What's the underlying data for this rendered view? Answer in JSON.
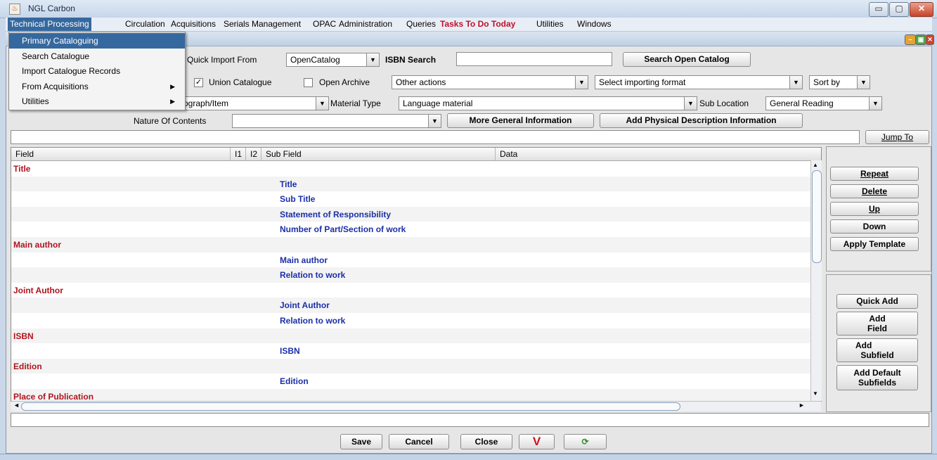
{
  "window": {
    "title": "NGL Carbon",
    "minimize_label": "▭",
    "maximize_label": "▢",
    "close_label": "✕"
  },
  "menubar": {
    "items": [
      {
        "label": "Technical Processing"
      },
      {
        "label": "Circulation"
      },
      {
        "label": "Acquisitions"
      },
      {
        "label": "Serials Management"
      },
      {
        "label": "OPAC"
      },
      {
        "label": "Administration"
      },
      {
        "label": "Queries"
      },
      {
        "label": "Tasks To Do Today"
      },
      {
        "label": "Utilities"
      },
      {
        "label": "Windows"
      }
    ]
  },
  "dropdown": {
    "items": [
      {
        "label": "Primary Cataloguing"
      },
      {
        "label": "Search Catalogue"
      },
      {
        "label": "Import Catalogue Records"
      },
      {
        "label": "From Acquisitions"
      },
      {
        "label": "Utilities"
      }
    ],
    "submenu_arrow": "▶"
  },
  "toolbar": {
    "quick_import_label": "Quick Import From",
    "quick_import_value": "OpenCatalog",
    "isbn_search_label": "ISBN Search",
    "isbn_search_value": "",
    "search_open_catalog": "Search Open Catalog",
    "union_catalogue_label": "Union Catalogue",
    "union_catalogue_checked": true,
    "open_archive_label": "Open Archive",
    "open_archive_checked": false,
    "other_actions_value": "Other actions",
    "importing_format_value": "Select importing format",
    "sort_by_value": "Sort by",
    "record_type_value": "ograph/Item",
    "material_type_label": "Material Type",
    "material_type_value": "Language material",
    "sub_location_label": "Sub Location",
    "sub_location_value": "General Reading",
    "nature_of_contents_label": "Nature Of Contents",
    "nature_of_contents_value": "",
    "more_general_info": "More General Information",
    "add_physical_desc": "Add Physical Description Information",
    "jump_to_value": "",
    "jump_to_label": "Jump To",
    "dropdown_arrow": "▼",
    "check_mark": "✓"
  },
  "table": {
    "columns": [
      "Field",
      "I1",
      "I2",
      "Sub Field",
      "Data"
    ],
    "rows": [
      {
        "field": "Title",
        "subfield": ""
      },
      {
        "field": "",
        "subfield": "Title"
      },
      {
        "field": "",
        "subfield": "Sub Title"
      },
      {
        "field": "",
        "subfield": "Statement of Responsibility"
      },
      {
        "field": "",
        "subfield": "Number of Part/Section of work"
      },
      {
        "field": "Main author",
        "subfield": ""
      },
      {
        "field": "",
        "subfield": "Main author"
      },
      {
        "field": "",
        "subfield": "Relation to work"
      },
      {
        "field": "Joint Author",
        "subfield": ""
      },
      {
        "field": "",
        "subfield": "Joint Author"
      },
      {
        "field": "",
        "subfield": "Relation to work"
      },
      {
        "field": "ISBN",
        "subfield": ""
      },
      {
        "field": "",
        "subfield": "ISBN"
      },
      {
        "field": "Edition",
        "subfield": ""
      },
      {
        "field": "",
        "subfield": "Edition"
      },
      {
        "field": "Place of Publication",
        "subfield": ""
      }
    ],
    "scroll_up": "▲",
    "scroll_down": "▼",
    "scroll_left": "◄",
    "scroll_right": "►"
  },
  "side_panel": {
    "repeat": "Repeat",
    "delete": "Delete",
    "up": "Up",
    "down": "Down",
    "apply_template": "Apply Template",
    "quick_add": "Quick Add",
    "add_field_1": "Add",
    "add_field_2": "Field",
    "add_subfield_1": "Add",
    "add_subfield_2": "Subfield",
    "add_default_1": "Add Default",
    "add_default_2": "Subfields"
  },
  "footer": {
    "status_value": "",
    "save": "Save",
    "cancel": "Cancel",
    "close": "Close",
    "validate_icon": "V",
    "refresh_icon": "⟳"
  },
  "colors": {
    "accent": "#35689e",
    "field_text": "#b0141e",
    "subfield_text": "#1b2fa8",
    "todo_text": "#c0102a"
  }
}
